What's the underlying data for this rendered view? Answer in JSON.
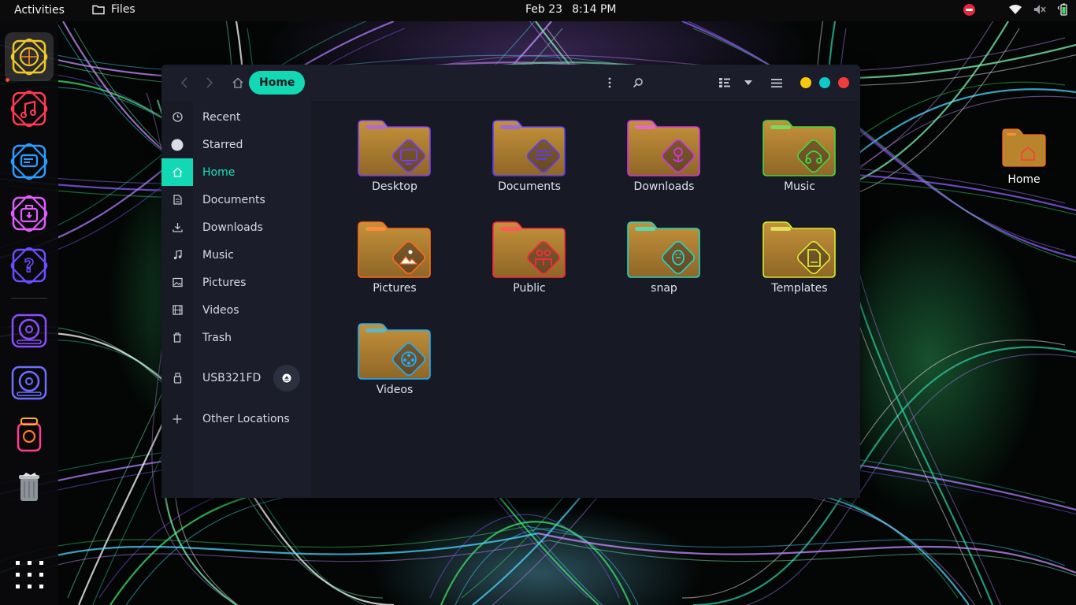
{
  "topbar": {
    "activities": "Activities",
    "app_name": "Files",
    "date": "Feb 23",
    "time": "8:14 PM"
  },
  "dock": {
    "items": [
      {
        "name": "gnome-browser-icon",
        "color": "#f0c82a"
      },
      {
        "name": "music-player-icon",
        "color": "#ff3b52"
      },
      {
        "name": "chat-app-icon",
        "color": "#2c9cff"
      },
      {
        "name": "software-store-icon",
        "color": "#e05cff"
      },
      {
        "name": "help-icon",
        "color": "#6b4dff"
      },
      {
        "name": "disk-usage-icon",
        "color": "#8a4dff"
      },
      {
        "name": "disk-utility-icon",
        "color": "#6e6dff"
      },
      {
        "name": "settings-app-icon",
        "color": "#ff3d8a"
      },
      {
        "name": "trash-icon",
        "color": "#9aa0a6"
      }
    ]
  },
  "desktop": {
    "home_label": "Home"
  },
  "window": {
    "path_label": "Home",
    "sidebar": [
      {
        "label": "Recent",
        "icon": "clock-icon"
      },
      {
        "label": "Starred",
        "icon": "star-icon"
      },
      {
        "label": "Home",
        "icon": "home-icon"
      },
      {
        "label": "Documents",
        "icon": "document-icon"
      },
      {
        "label": "Downloads",
        "icon": "download-icon"
      },
      {
        "label": "Music",
        "icon": "music-note-icon"
      },
      {
        "label": "Pictures",
        "icon": "image-icon"
      },
      {
        "label": "Videos",
        "icon": "film-icon"
      },
      {
        "label": "Trash",
        "icon": "trash-icon"
      },
      {
        "label": "USB321FD",
        "icon": "usb-drive-icon"
      },
      {
        "label": "Other Locations",
        "icon": "plus-icon"
      }
    ],
    "folders": [
      {
        "label": "Desktop",
        "accent": "#7b3cff",
        "tab": "#b06ad8",
        "glyph": "monitor"
      },
      {
        "label": "Documents",
        "accent": "#5a3cff",
        "tab": "#9a6ad8",
        "glyph": "doc"
      },
      {
        "label": "Downloads",
        "accent": "#d432e6",
        "tab": "#e46ac8",
        "glyph": "download"
      },
      {
        "label": "Music",
        "accent": "#42d83c",
        "tab": "#78d860",
        "glyph": "headphones"
      },
      {
        "label": "Pictures",
        "accent": "#ff6a1a",
        "tab": "#ff8a3c",
        "glyph": "picture"
      },
      {
        "label": "Public",
        "accent": "#ff2a3c",
        "tab": "#ff5a5a",
        "glyph": "people"
      },
      {
        "label": "snap",
        "accent": "#1ed8c4",
        "tab": "#5ad8b0",
        "glyph": "tux"
      },
      {
        "label": "Templates",
        "accent": "#d8ef2a",
        "tab": "#e0e05a",
        "glyph": "template"
      },
      {
        "label": "Videos",
        "accent": "#1aaeff",
        "tab": "#5ab8c8",
        "glyph": "reel"
      }
    ]
  },
  "colors": {
    "accent": "#12d9b3",
    "window_bg": "#1b1d2b",
    "content_bg": "#171925",
    "minimize": "#f6c90e",
    "maximize": "#12c9c9",
    "close": "#f23b3b"
  }
}
